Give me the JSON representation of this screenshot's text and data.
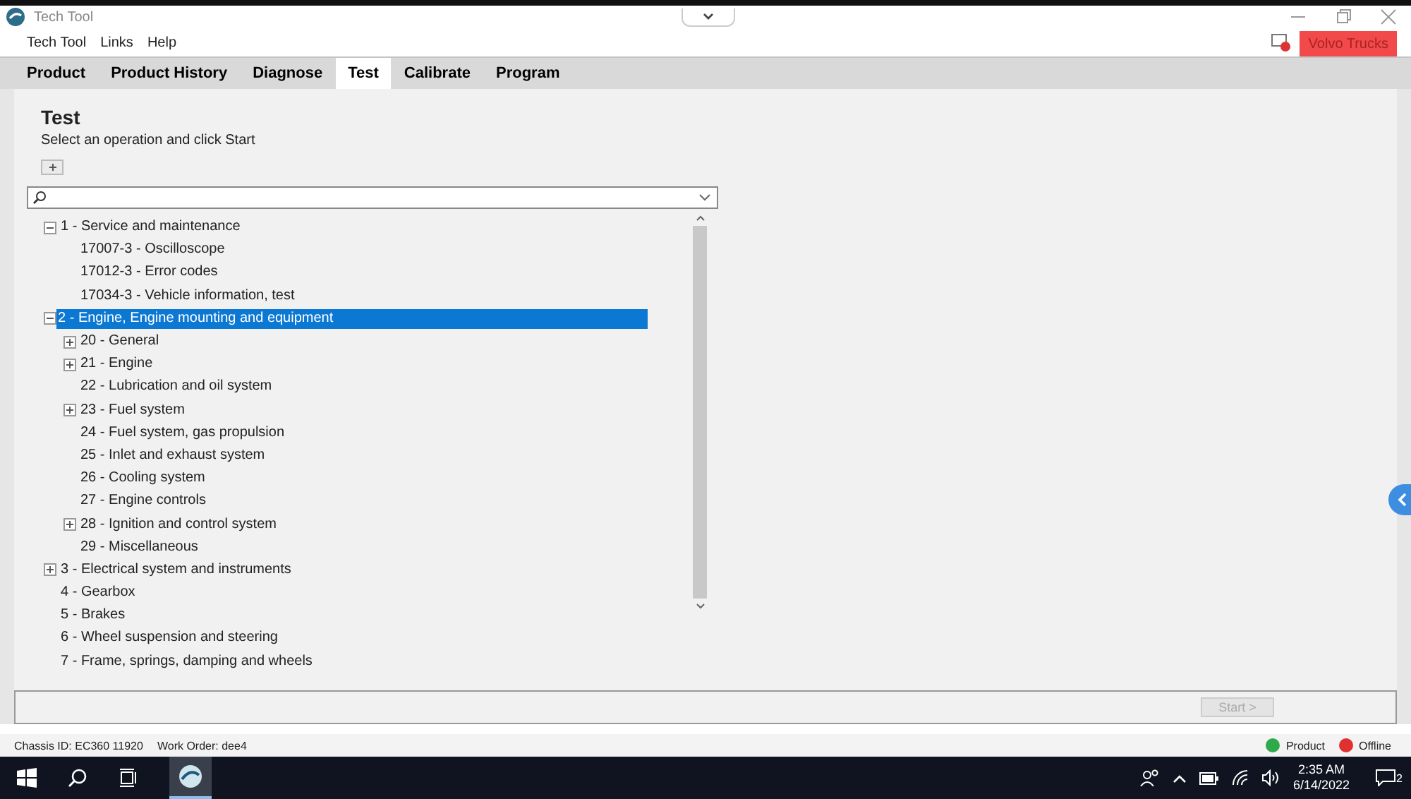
{
  "window": {
    "title": "Tech Tool"
  },
  "menu": [
    "Tech Tool",
    "Links",
    "Help"
  ],
  "brand_button": "Volvo Trucks",
  "tabs": [
    {
      "label": "Product",
      "selected": false
    },
    {
      "label": "Product History",
      "selected": false
    },
    {
      "label": "Diagnose",
      "selected": false
    },
    {
      "label": "Test",
      "selected": true
    },
    {
      "label": "Calibrate",
      "selected": false
    },
    {
      "label": "Program",
      "selected": false
    }
  ],
  "page": {
    "heading": "Test",
    "instruction": "Select an operation and click Start"
  },
  "tree": [
    {
      "label": "1 - Service and maintenance",
      "expanded": true,
      "selected": false,
      "children": [
        {
          "label": "17007-3 - Oscilloscope",
          "selected": false
        },
        {
          "label": "17012-3 - Error codes",
          "selected": false
        },
        {
          "label": "17034-3 - Vehicle information, test",
          "selected": false
        }
      ]
    },
    {
      "label": "2 - Engine, Engine mounting and equipment",
      "expanded": true,
      "selected": true,
      "children": [
        {
          "label": "20 - General",
          "expanded": false,
          "selected": false
        },
        {
          "label": "21 - Engine",
          "expanded": false,
          "selected": false
        },
        {
          "label": "22 - Lubrication and oil system",
          "selected": false
        },
        {
          "label": "23 - Fuel system",
          "expanded": false,
          "selected": false
        },
        {
          "label": "24 - Fuel system, gas propulsion",
          "selected": false
        },
        {
          "label": "25 - Inlet and exhaust system",
          "selected": false
        },
        {
          "label": "26 - Cooling system",
          "selected": false
        },
        {
          "label": "27 - Engine controls",
          "selected": false
        },
        {
          "label": "28 - Ignition and control system",
          "expanded": false,
          "selected": false
        },
        {
          "label": "29 - Miscellaneous",
          "selected": false
        }
      ]
    },
    {
      "label": "3 - Electrical system and instruments",
      "expanded": false,
      "selected": false
    },
    {
      "label": "4 - Gearbox",
      "selected": false
    },
    {
      "label": "5 - Brakes",
      "selected": false
    },
    {
      "label": "6 - Wheel suspension and steering",
      "selected": false
    },
    {
      "label": "7 - Frame, springs, damping and wheels",
      "selected": false
    }
  ],
  "start_button": {
    "label": "Start >",
    "disabled": true
  },
  "status_bar": {
    "chassis": "Chassis ID: EC360 11920",
    "work_order": "Work Order: dee4",
    "indicators": [
      {
        "label": "Product",
        "color": "#2eaa4a"
      },
      {
        "label": "Offline",
        "color": "#e03030"
      }
    ]
  },
  "taskbar": {
    "time": "2:35 AM",
    "date": "6/14/2022",
    "notifications": "2"
  }
}
